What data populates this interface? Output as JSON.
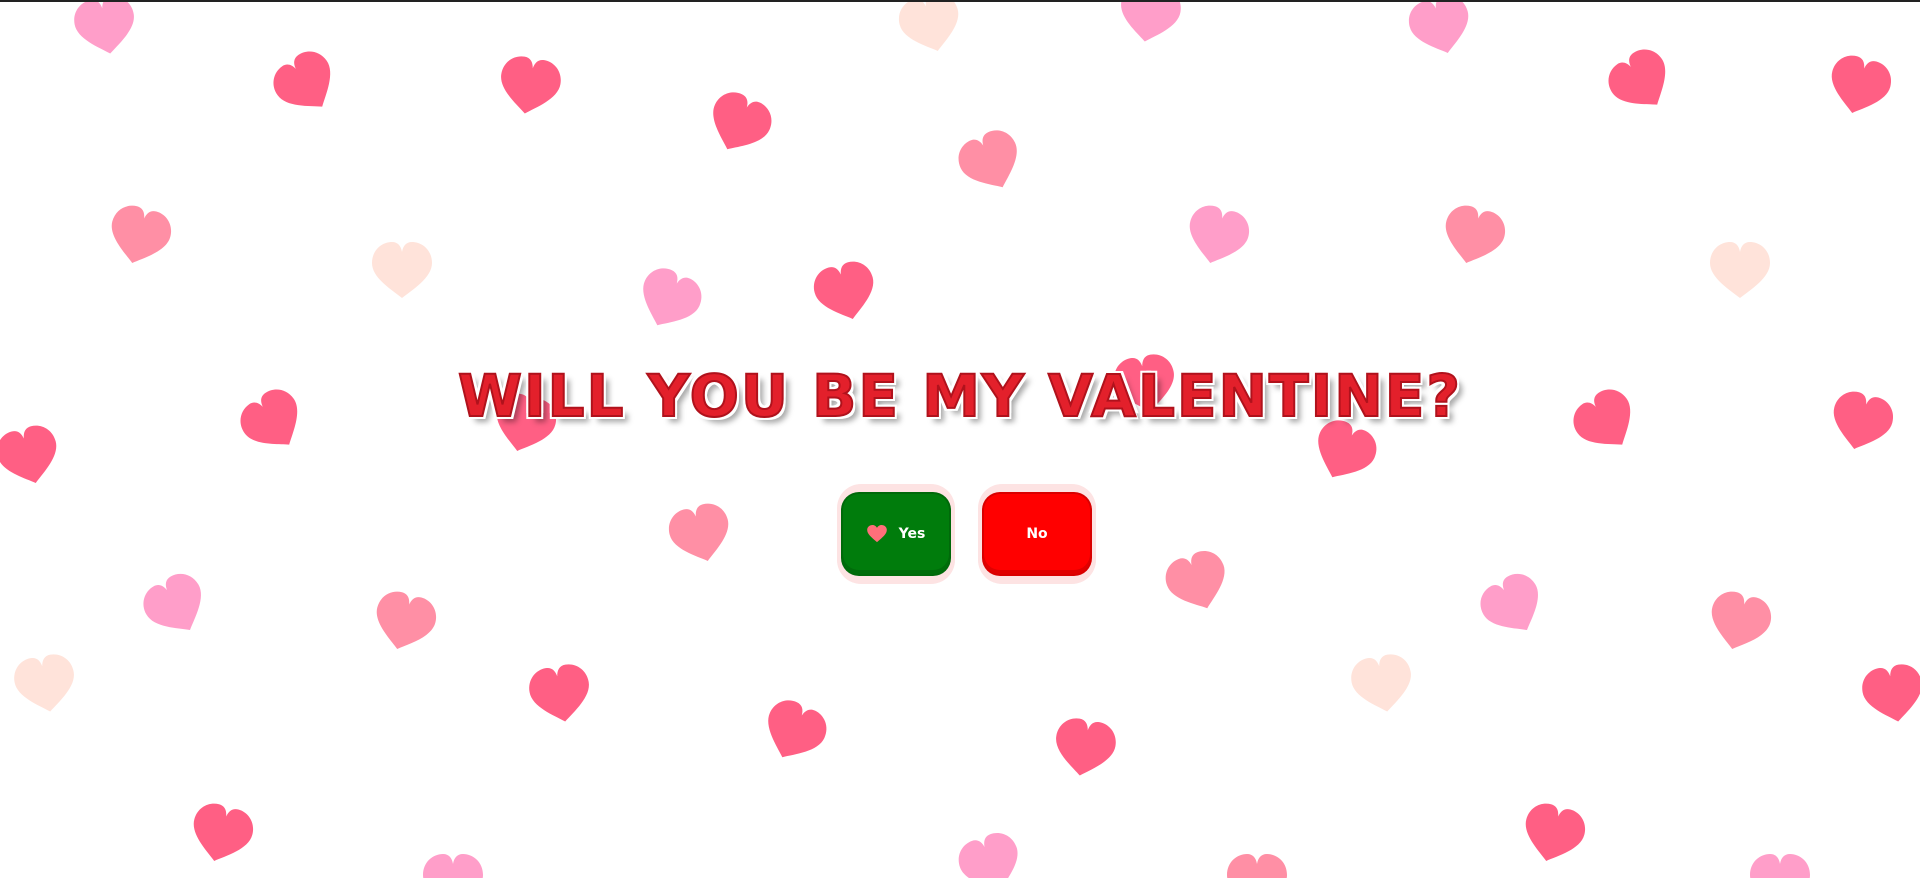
{
  "page": {
    "title": "WILL YOU BE MY VALENTINE?"
  },
  "buttons": {
    "yes_label": "Yes",
    "yes_icon": "heart-icon",
    "yes_color": "#007c0c",
    "no_label": "No",
    "no_color": "#ff0000"
  },
  "colors": {
    "title": "#e3202b",
    "heart_palette": [
      "#ff5f84",
      "#ff8fa5",
      "#ff9ec9",
      "#ffe3da"
    ]
  }
}
